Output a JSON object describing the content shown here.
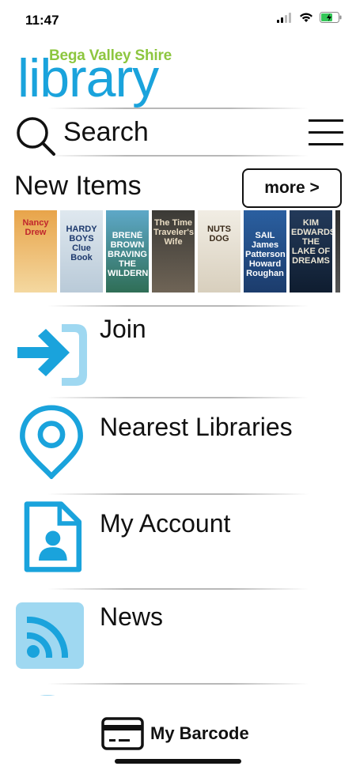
{
  "status_bar": {
    "time": "11:47"
  },
  "logo": {
    "subtitle": "Bega Valley Shire",
    "title": "library"
  },
  "search": {
    "label": "Search"
  },
  "new_items": {
    "title": "New Items",
    "more_label": "more >",
    "books": [
      {
        "title": "Nancy Drew",
        "colors": [
          "#e8a44a",
          "#f4d8a0"
        ],
        "text_color": "#c0252d"
      },
      {
        "title": "HARDY BOYS Clue Book",
        "colors": [
          "#dfe8ef",
          "#b9cad8"
        ],
        "text_color": "#1e3a6e"
      },
      {
        "title": "BRENÉ BROWN BRAVING THE WILDERNESS",
        "colors": [
          "#5ea8c8",
          "#2f6e56"
        ],
        "text_color": "#ffffff"
      },
      {
        "title": "The Time Traveler's Wife",
        "colors": [
          "#3b3a36",
          "#6f6456"
        ],
        "text_color": "#e9dcc3"
      },
      {
        "title": "NUTS DOG",
        "colors": [
          "#f1ede4",
          "#d8cfbd"
        ],
        "text_color": "#3a2b1a"
      },
      {
        "title": "SAIL James Patterson Howard Roughan",
        "colors": [
          "#2a5fa0",
          "#1c3c6c"
        ],
        "text_color": "#ffffff"
      },
      {
        "title": "KIM EDWARDS THE LAKE OF DREAMS",
        "colors": [
          "#233a5a",
          "#0f1d30"
        ],
        "text_color": "#e8e3d2"
      },
      {
        "title": "",
        "colors": [
          "#2e2e2e",
          "#555555"
        ],
        "text_color": "#ffffff"
      }
    ]
  },
  "menu": [
    {
      "label": "Join",
      "icon": "join-arrow-icon"
    },
    {
      "label": "Nearest Libraries",
      "icon": "location-pin-icon"
    },
    {
      "label": "My Account",
      "icon": "account-document-icon"
    },
    {
      "label": "News",
      "icon": "rss-feed-icon"
    }
  ],
  "bottom": {
    "barcode_label": "My Barcode",
    "icon": "barcode-card-icon"
  },
  "colors": {
    "brand_blue": "#1aa3dc",
    "light_blue": "#9fd8f1",
    "brand_green": "#8dc63f"
  }
}
